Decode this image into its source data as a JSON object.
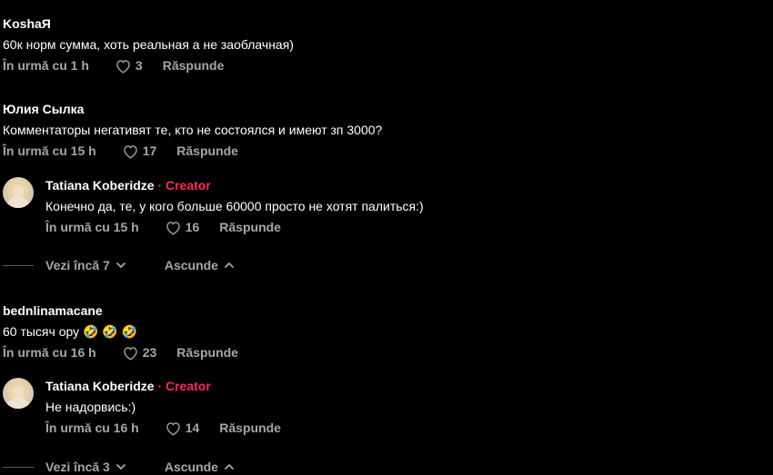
{
  "comments": [
    {
      "username": "KoshaЯ",
      "text": "60к норм сумма, хоть реальная а не заоблачная)",
      "time": "În urmă cu 1 h",
      "likes": "3",
      "reply_label": "Răspunde"
    },
    {
      "username": "Юлия Сылка",
      "text": "Комментаторы негативят те, кто не состоялся и имеют зп 3000?",
      "time": "În urmă cu 15 h",
      "likes": "17",
      "reply_label": "Răspunde",
      "replies": [
        {
          "username": "Tatiana Koberidze",
          "creator_badge": "· Creator",
          "text": "Конечно да, те, у кого больше 60000 просто не хотят палиться:)",
          "time": "În urmă cu 15 h",
          "likes": "16",
          "reply_label": "Răspunde"
        }
      ],
      "view_more": "Vezi încă 7",
      "hide": "Ascunde"
    },
    {
      "username": "bednlinamacane",
      "text": "60 тысяч ору 🤣 🤣 🤣",
      "time": "În urmă cu 16 h",
      "likes": "23",
      "reply_label": "Răspunde",
      "replies": [
        {
          "username": "Tatiana Koberidze",
          "creator_badge": "· Creator",
          "text": "Не надорвись:)",
          "time": "În urmă cu 16 h",
          "likes": "14",
          "reply_label": "Răspunde"
        }
      ],
      "view_more": "Vezi încă 3",
      "hide": "Ascunde"
    }
  ],
  "colors": {
    "background": "#000000",
    "text": "#ffffff",
    "muted": "#a6a6a6",
    "creator": "#fe2c55"
  },
  "icons": {
    "like": "heart-outline-icon",
    "expand": "chevron-down-icon",
    "collapse": "chevron-up-icon",
    "avatar": "avatar"
  }
}
